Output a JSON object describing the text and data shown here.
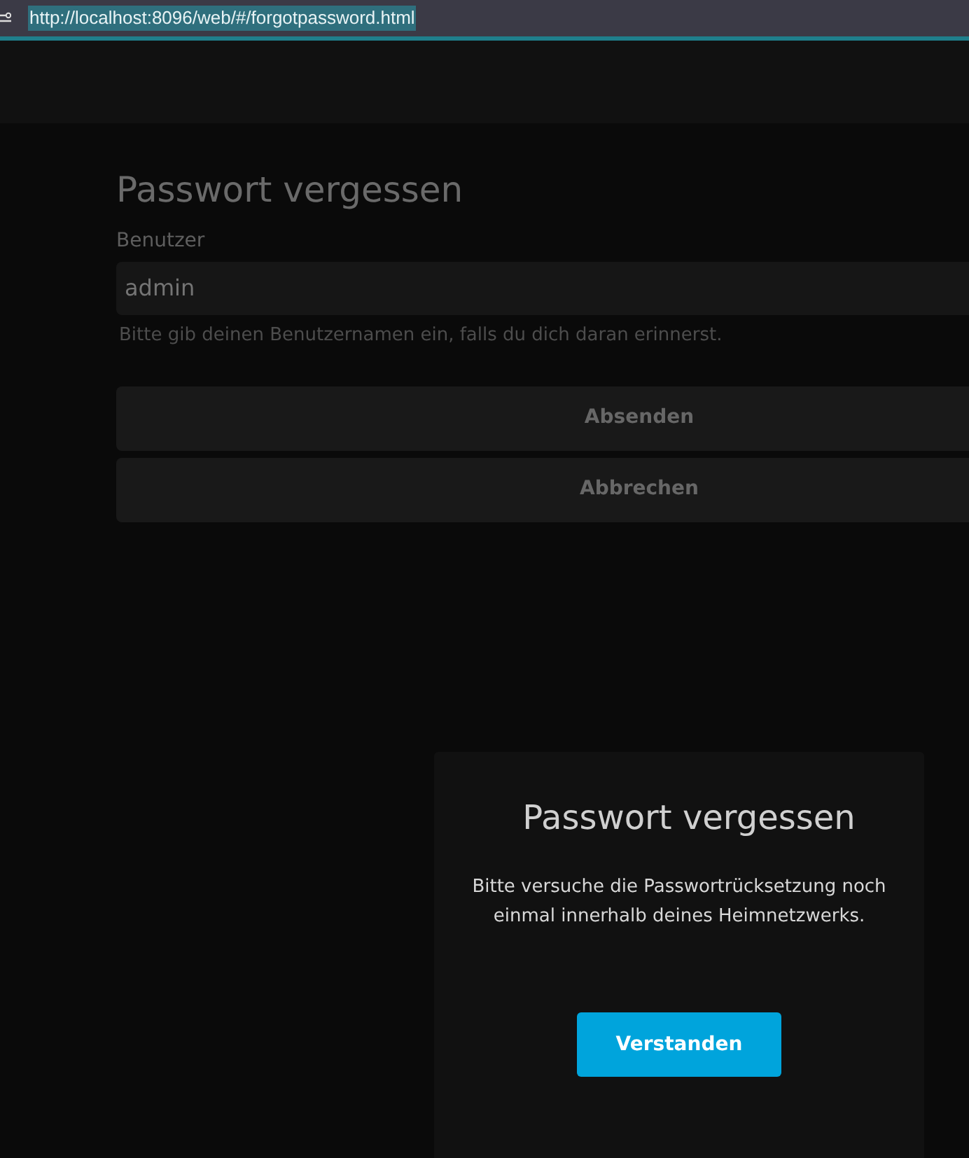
{
  "address_bar": {
    "url": "http://localhost:8096/web/#/forgotpassword.html"
  },
  "form": {
    "title": "Passwort vergessen",
    "field_label": "Benutzer",
    "field_value": "admin",
    "hint": "Bitte gib deinen Benutzernamen ein, falls du dich daran erinnerst.",
    "buttons": [
      "Absenden",
      "Abbrechen"
    ]
  },
  "dialog": {
    "title": "Passwort vergessen",
    "message": "Bitte versuche die Passwortrücksetzung noch einmal innerhalb deines Heimnetzwerks.",
    "button": "Verstanden"
  }
}
